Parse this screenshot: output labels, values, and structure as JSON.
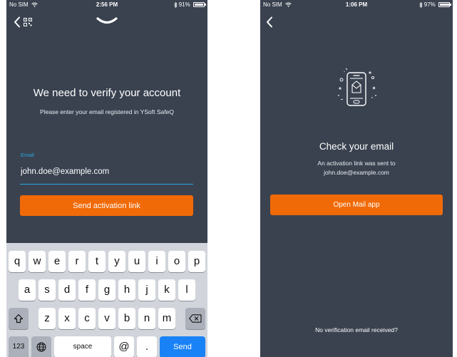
{
  "left_screen": {
    "status": {
      "carrier": "No SIM",
      "time": "2:56 PM",
      "battery": "91%",
      "battery_level": 0.91
    },
    "heading": "We need to verify your account",
    "subtext": "Please enter your email registered in YSoft SafeQ",
    "email_label": "Email",
    "email_value": "john.doe@example.com",
    "send_button": "Send activation link",
    "keyboard": {
      "row1": [
        "q",
        "w",
        "e",
        "r",
        "t",
        "y",
        "u",
        "i",
        "o",
        "p"
      ],
      "row2": [
        "a",
        "s",
        "d",
        "f",
        "g",
        "h",
        "j",
        "k",
        "l"
      ],
      "row3": [
        "z",
        "x",
        "c",
        "v",
        "b",
        "n",
        "m"
      ],
      "numbers_key": "123",
      "space_key": "space",
      "at_key": "@",
      "dot_key": ".",
      "send_key": "Send"
    }
  },
  "right_screen": {
    "status": {
      "carrier": "No SIM",
      "time": "1:06 PM",
      "battery": "97%",
      "battery_level": 0.97
    },
    "heading": "Check your email",
    "message_line1": "An activation link was sent to",
    "message_line2": "john.doe@example.com",
    "open_mail_button": "Open Mail app",
    "no_email_link": "No verification email received?"
  },
  "icons": {
    "back": "chevron-left-icon",
    "qr": "qr-code-icon",
    "logo": "ysoft-logo-icon",
    "wifi": "wifi-icon",
    "bluetooth": "bluetooth-icon",
    "battery": "battery-icon",
    "shift": "shift-icon",
    "delete": "backspace-icon",
    "globe": "globe-icon",
    "mail": "phone-mail-illustration"
  },
  "colors": {
    "background": "#3a4250",
    "accent": "#f16a08",
    "input_underline": "#2aa6e0",
    "keyboard_send": "#1a82f7"
  }
}
